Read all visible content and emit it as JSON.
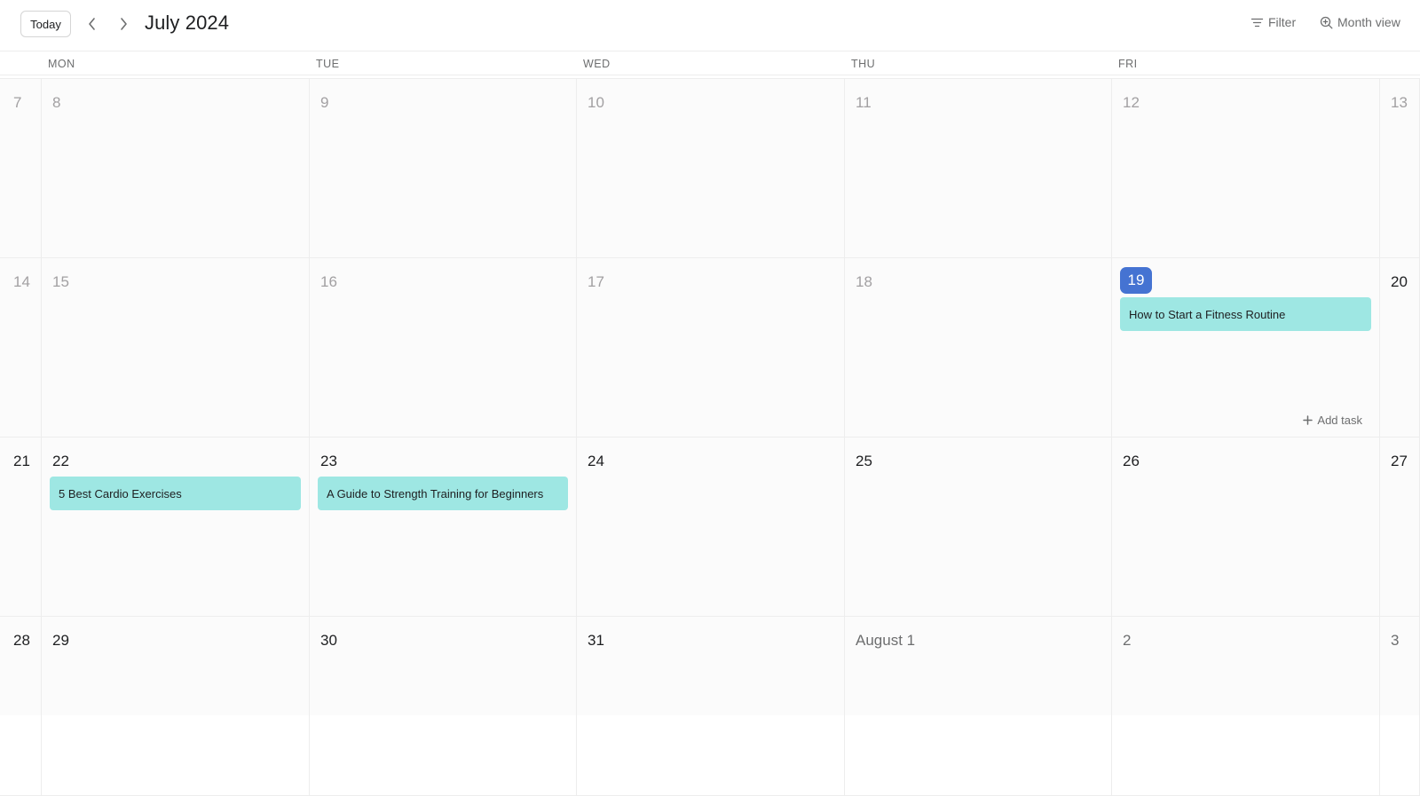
{
  "header": {
    "today_label": "Today",
    "title": "July 2024",
    "filter_label": "Filter",
    "view_label": "Month view"
  },
  "weekdays": [
    "MON",
    "TUE",
    "WED",
    "THU",
    "FRI"
  ],
  "colors": {
    "today_chip": "#4573d2",
    "task_bg": "#9ee7e3"
  },
  "weeks": [
    {
      "days": [
        {
          "label": "7",
          "state": "past"
        },
        {
          "label": "8",
          "state": "past"
        },
        {
          "label": "9",
          "state": "past"
        },
        {
          "label": "10",
          "state": "past"
        },
        {
          "label": "11",
          "state": "past"
        },
        {
          "label": "12",
          "state": "past"
        },
        {
          "label": "13",
          "state": "past"
        }
      ]
    },
    {
      "days": [
        {
          "label": "14",
          "state": "past"
        },
        {
          "label": "15",
          "state": "past"
        },
        {
          "label": "16",
          "state": "past"
        },
        {
          "label": "17",
          "state": "past"
        },
        {
          "label": "18",
          "state": "past"
        },
        {
          "label": "19",
          "state": "today",
          "task": "How to Start a Fitness Routine",
          "add_task": "Add task"
        },
        {
          "label": "20",
          "state": "current"
        }
      ]
    },
    {
      "days": [
        {
          "label": "21",
          "state": "current"
        },
        {
          "label": "22",
          "state": "current",
          "task": "5 Best Cardio Exercises"
        },
        {
          "label": "23",
          "state": "current",
          "task": "A Guide to Strength Training for Beginners"
        },
        {
          "label": "24",
          "state": "current"
        },
        {
          "label": "25",
          "state": "current"
        },
        {
          "label": "26",
          "state": "current"
        },
        {
          "label": "27",
          "state": "current"
        }
      ]
    },
    {
      "days": [
        {
          "label": "28",
          "state": "current"
        },
        {
          "label": "29",
          "state": "current"
        },
        {
          "label": "30",
          "state": "current"
        },
        {
          "label": "31",
          "state": "current"
        },
        {
          "label": "August 1",
          "state": "next-month"
        },
        {
          "label": "2",
          "state": "next-month"
        },
        {
          "label": "3",
          "state": "next-month"
        }
      ]
    }
  ]
}
